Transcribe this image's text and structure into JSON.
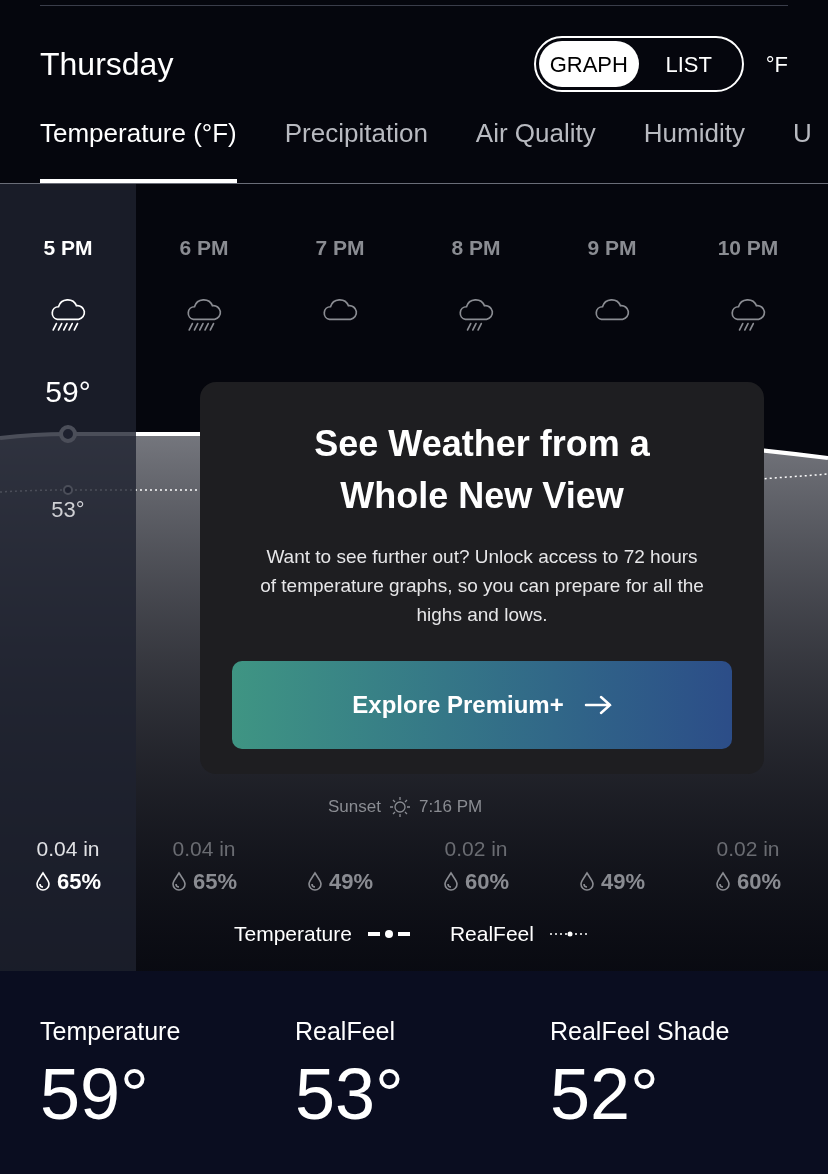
{
  "header": {
    "day": "Thursday",
    "view_toggle": [
      {
        "label": "GRAPH",
        "selected": true
      },
      {
        "label": "LIST",
        "selected": false
      }
    ],
    "unit": "°F"
  },
  "tabs": [
    {
      "label": "Temperature (°F)",
      "selected": true
    },
    {
      "label": "Precipitation",
      "selected": false
    },
    {
      "label": "Air Quality",
      "selected": false
    },
    {
      "label": "Humidity",
      "selected": false
    },
    {
      "label": "U",
      "selected": false
    }
  ],
  "hours": [
    {
      "time": "5 PM",
      "kind": "heavy",
      "selected": true,
      "temperature": "59°",
      "realfeel": "53°",
      "amount": "0.04 in",
      "chance": "65%"
    },
    {
      "time": "6 PM",
      "kind": "heavy",
      "selected": false,
      "amount": "0.04 in",
      "chance": "65%"
    },
    {
      "time": "7 PM",
      "kind": "cloudy",
      "selected": false,
      "chance": "49%"
    },
    {
      "time": "8 PM",
      "kind": "light",
      "selected": false,
      "amount": "0.02 in",
      "chance": "60%"
    },
    {
      "time": "9 PM",
      "kind": "cloudy",
      "selected": false,
      "chance": "49%"
    },
    {
      "time": "10 PM",
      "kind": "light",
      "selected": false,
      "amount": "0.02 in",
      "chance": "60%"
    }
  ],
  "sunset": {
    "label": "Sunset",
    "time": "7:16 PM"
  },
  "legend": [
    {
      "label": "Temperature",
      "kind": "solid"
    },
    {
      "label": "RealFeel",
      "kind": "dotted"
    }
  ],
  "promo": {
    "title": "See Weather from a Whole New View",
    "text": "Want to see further out? Unlock access to 72 hours of temperature graphs, so you can prepare for all the highs and lows.",
    "button": "Explore Premium+"
  },
  "stats": [
    {
      "label": "Temperature",
      "value": "59°"
    },
    {
      "label": "RealFeel",
      "value": "53°"
    },
    {
      "label": "RealFeel Shade",
      "value": "52°"
    }
  ]
}
